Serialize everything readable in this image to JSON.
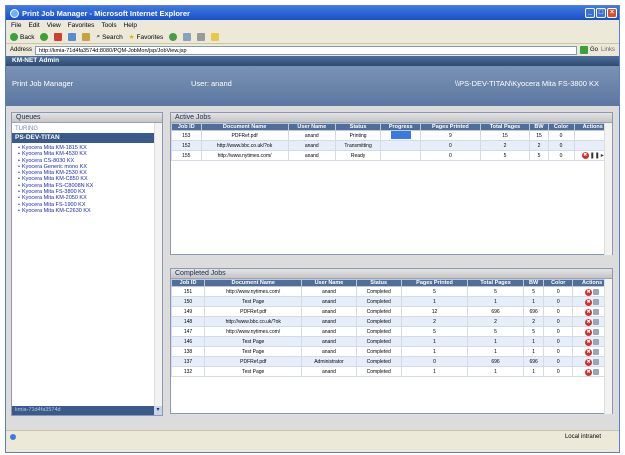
{
  "window": {
    "title": "Print Job Manager - Microsoft Internet Explorer"
  },
  "menu": [
    "File",
    "Edit",
    "View",
    "Favorites",
    "Tools",
    "Help"
  ],
  "toolbar": {
    "back": "Back",
    "search": "Search",
    "favorites": "Favorites"
  },
  "address": {
    "label": "Address",
    "url": "http://kmia-71d4fa3574d:8080/PQM-JobMon/jsp/JobView.jsp",
    "go": "Go",
    "links": "Links"
  },
  "app": {
    "brand": "KM-NET Admin",
    "title": "Print Job Manager",
    "user": "User: anand",
    "printer": "\\\\PS-DEV-TITAN\\Kyocera Mita FS-3800 KX"
  },
  "queues": {
    "title": "Queues",
    "server1": "TURING",
    "server2": "PS-DEV-TITAN",
    "items": [
      "Kyocera Mita KM-1815 KX",
      "Kyocera Mita KM-4530 KX",
      "Kyocera CS-8030 KX",
      "Kyocera Generic mono KX",
      "Kyocera Mita KM-2530 KX",
      "Kyocera Mita KM-C850 KX",
      "Kyocera Mita FS-C8008N KX",
      "Kyocera Mita FS-3800 KX",
      "Kyocera Mita KM-2050 KX",
      "Kyocera Mita FS-1900 KX",
      "Kyocera Mita KM-C2630 KX"
    ],
    "footer": "kmia-71d4fa3574d"
  },
  "active": {
    "title": "Active Jobs",
    "headers": [
      "Job ID",
      "Document Name",
      "User Name",
      "Status",
      "Progress",
      "Pages Printed",
      "Total Pages",
      "BW",
      "Color",
      "Actions"
    ],
    "rows": [
      {
        "id": "153",
        "doc": "PDFRef.pdf",
        "user": "anand",
        "status": "Printing",
        "progress": 0.6,
        "printed": "9",
        "total": "15",
        "bw": "15",
        "color": "0"
      },
      {
        "id": "152",
        "doc": "http://www.bbc.co.uk/?ok",
        "user": "anand",
        "status": "Transmitting",
        "progress": 0,
        "printed": "0",
        "total": "2",
        "bw": "2",
        "color": "0"
      },
      {
        "id": "155",
        "doc": "http://www.nytimes.com/",
        "user": "anand",
        "status": "Ready",
        "progress": 0,
        "printed": "0",
        "total": "5",
        "bw": "5",
        "color": "0"
      }
    ]
  },
  "completed": {
    "title": "Completed Jobs",
    "headers": [
      "Job ID",
      "Document Name",
      "User Name",
      "Status",
      "Pages Printed",
      "Total Pages",
      "BW",
      "Color",
      "Actions"
    ],
    "rows": [
      {
        "id": "151",
        "doc": "http://www.nytimes.com/",
        "user": "anand",
        "status": "Completed",
        "printed": "5",
        "total": "5",
        "bw": "5",
        "color": "0"
      },
      {
        "id": "150",
        "doc": "Test Page",
        "user": "anand",
        "status": "Completed",
        "printed": "1",
        "total": "1",
        "bw": "1",
        "color": "0"
      },
      {
        "id": "149",
        "doc": "PDFRef.pdf",
        "user": "anand",
        "status": "Completed",
        "printed": "12",
        "total": "696",
        "bw": "696",
        "color": "0"
      },
      {
        "id": "148",
        "doc": "http://www.bbc.co.uk/?ok",
        "user": "anand",
        "status": "Completed",
        "printed": "2",
        "total": "2",
        "bw": "2",
        "color": "0"
      },
      {
        "id": "147",
        "doc": "http://www.nytimes.com/",
        "user": "anand",
        "status": "Completed",
        "printed": "5",
        "total": "5",
        "bw": "5",
        "color": "0"
      },
      {
        "id": "146",
        "doc": "Test Page",
        "user": "anand",
        "status": "Completed",
        "printed": "1",
        "total": "1",
        "bw": "1",
        "color": "0"
      },
      {
        "id": "138",
        "doc": "Test Page",
        "user": "anand",
        "status": "Completed",
        "printed": "1",
        "total": "1",
        "bw": "1",
        "color": "0"
      },
      {
        "id": "137",
        "doc": "PDFRef.pdf",
        "user": "Administrator",
        "status": "Completed",
        "printed": "0",
        "total": "696",
        "bw": "696",
        "color": "0"
      },
      {
        "id": "132",
        "doc": "Test Page",
        "user": "anand",
        "status": "Completed",
        "printed": "1",
        "total": "1",
        "bw": "1",
        "color": "0"
      }
    ]
  },
  "status": {
    "zone": "Local intranet"
  }
}
